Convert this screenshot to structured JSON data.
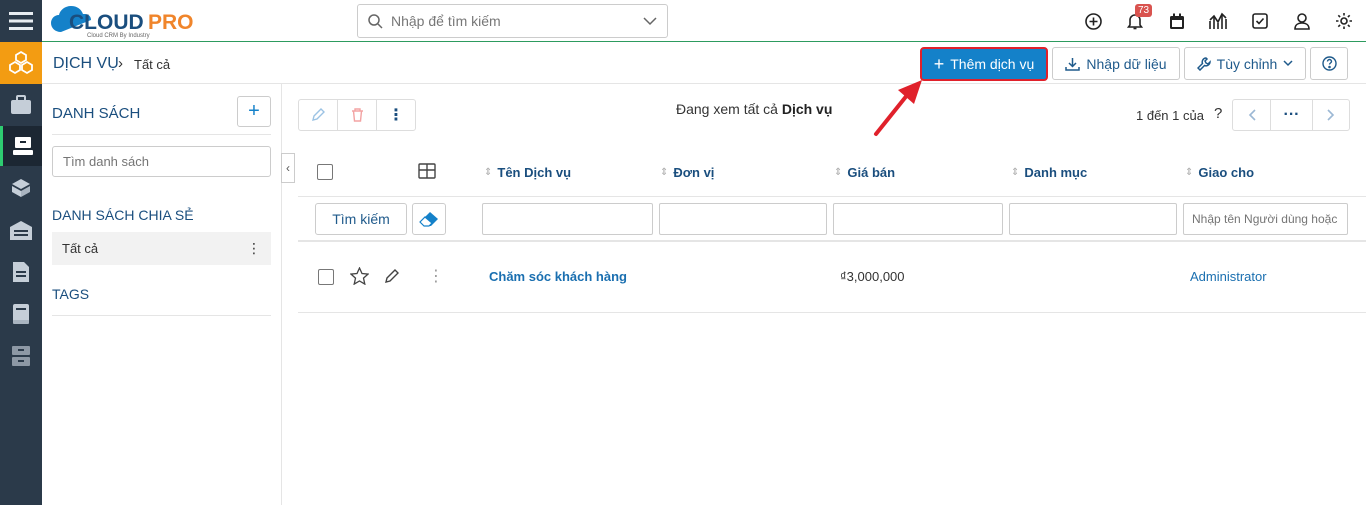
{
  "app": {
    "logo_text": "CLOUDPRO",
    "logo_tagline": "Cloud CRM By Industry"
  },
  "search": {
    "placeholder": "Nhập để tìm kiếm"
  },
  "notifications": {
    "count": "73"
  },
  "colors": {
    "brand_blue": "#1481c9",
    "sidebar_bg": "#2b3a4a",
    "home_orange": "#f39c12",
    "heading_blue": "#1a4e7e",
    "highlight_red": "#e0212b"
  },
  "breadcrumb": {
    "module": "DỊCH VỤ",
    "separator": "›",
    "filter": "Tất cả"
  },
  "actions": {
    "add_label": "Thêm dịch vụ",
    "import_label": "Nhập dữ liệu",
    "customize_label": "Tùy chỉnh"
  },
  "list_panel": {
    "title": "DANH SÁCH",
    "search_placeholder": "Tìm danh sách",
    "shared_title": "DANH SÁCH CHIA SẺ",
    "shared_items": [
      {
        "label": "Tất cả"
      }
    ],
    "tags_title": "TAGS"
  },
  "viewing": {
    "prefix": "Đang xem tất cả",
    "module": "Dịch vụ"
  },
  "pagination": {
    "range": "1 đến 1 của",
    "help": "?"
  },
  "table": {
    "columns": [
      "Tên Dịch vụ",
      "Đơn vị",
      "Giá bán",
      "Danh mục",
      "Giao cho"
    ],
    "search_button": "Tìm kiếm",
    "assignee_filter_placeholder": "Nhập tên Người dùng hoặc",
    "rows": [
      {
        "name": "Chăm sóc khách hàng",
        "unit": "",
        "price": "₫3,000,000",
        "category": "",
        "assignee": "Administrator"
      }
    ]
  }
}
